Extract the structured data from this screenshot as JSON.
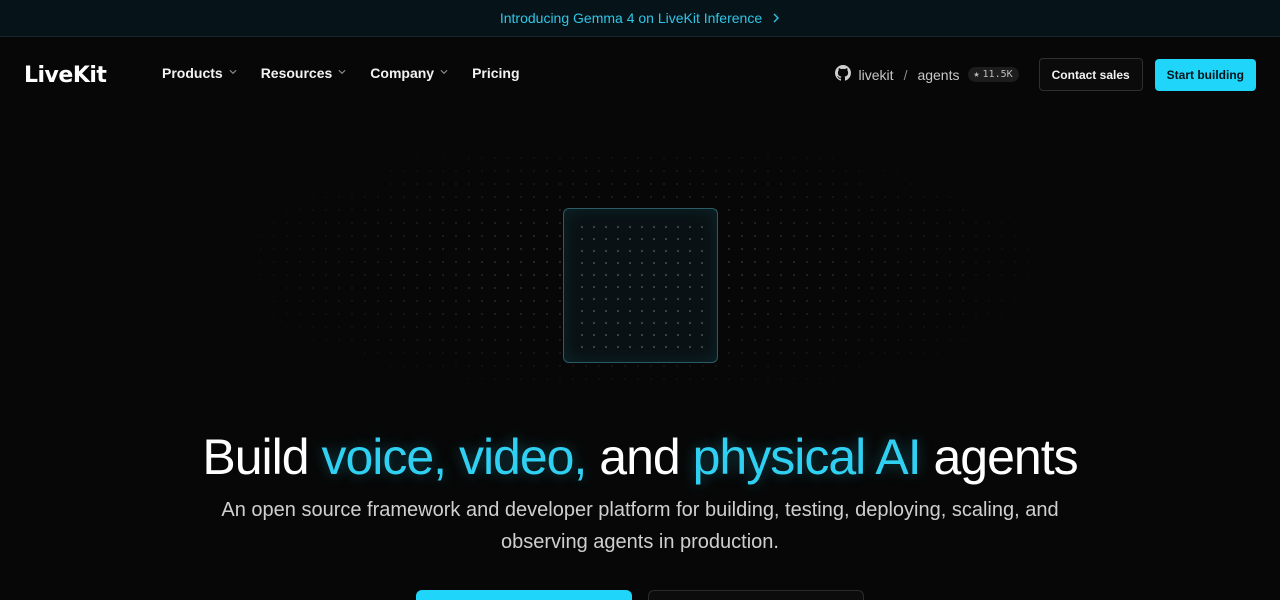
{
  "announcement": {
    "text": "Introducing Gemma 4 on LiveKit Inference",
    "icon": "chevron-right-icon",
    "accent": "#2fc6e6"
  },
  "nav": {
    "logo": "LiveKit",
    "items": [
      {
        "label": "Products",
        "has_dropdown": true
      },
      {
        "label": "Resources",
        "has_dropdown": true
      },
      {
        "label": "Company",
        "has_dropdown": true
      },
      {
        "label": "Pricing",
        "has_dropdown": false
      }
    ],
    "github": {
      "org": "livekit",
      "separator": "/",
      "repo": "agents",
      "stars": "11.5K",
      "icon": "github-icon",
      "star_icon": "star-icon"
    },
    "contact_label": "Contact sales",
    "start_label": "Start building"
  },
  "hero": {
    "headline": {
      "part1": "Build ",
      "accent1": "voice, video,",
      "part2": " and ",
      "accent2": "physical AI",
      "part3": " agents"
    },
    "subhead": "An open source framework and developer platform for building, testing, deploying, scaling, and observing agents in production.",
    "accent_color": "#1fd5f9"
  }
}
